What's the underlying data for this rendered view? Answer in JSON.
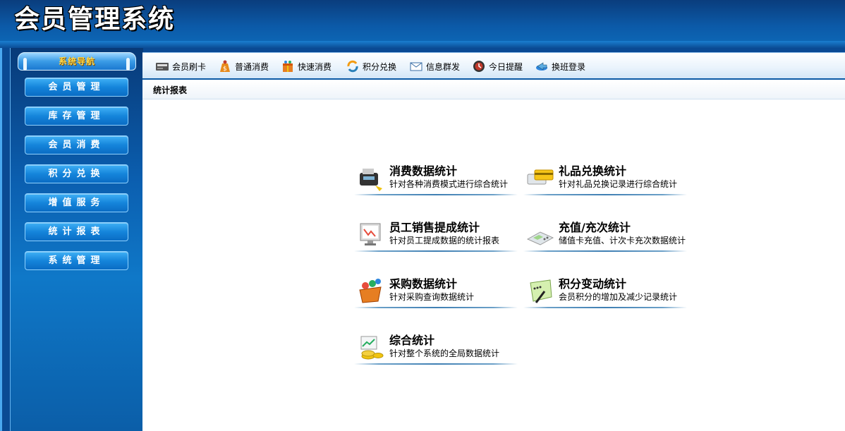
{
  "header": {
    "title": "会员管理系统"
  },
  "sidebar": {
    "heading": "系统导航",
    "items": [
      {
        "label": "会员管理"
      },
      {
        "label": "库存管理"
      },
      {
        "label": "会员消费"
      },
      {
        "label": "积分兑换"
      },
      {
        "label": "增值服务"
      },
      {
        "label": "统计报表"
      },
      {
        "label": "系统管理"
      }
    ]
  },
  "toolbar": {
    "items": [
      {
        "label": "会员刷卡",
        "icon": "card-reader-icon"
      },
      {
        "label": "普通消费",
        "icon": "money-bag-icon"
      },
      {
        "label": "快速消费",
        "icon": "gift-box-icon"
      },
      {
        "label": "积分兑换",
        "icon": "exchange-arrows-icon"
      },
      {
        "label": "信息群发",
        "icon": "envelope-icon"
      },
      {
        "label": "今日提醒",
        "icon": "alarm-icon"
      },
      {
        "label": "换班登录",
        "icon": "shift-login-icon"
      }
    ]
  },
  "content": {
    "title": "统计报表",
    "stats": [
      {
        "name": "消费数据统计",
        "desc": "针对各种消费模式进行综合统计",
        "icon": "pos-machine-icon"
      },
      {
        "name": "礼品兑换统计",
        "desc": "针对礼品兑换记录进行综合统计",
        "icon": "gift-cards-icon"
      },
      {
        "name": "员工销售提成统计",
        "desc": "针对员工提成数据的统计报表",
        "icon": "monitor-chart-icon"
      },
      {
        "name": "充值/充次统计",
        "desc": "储值卡充值、计次卡充次数据统计",
        "icon": "calculator-icon"
      },
      {
        "name": "采购数据统计",
        "desc": "针对采购查询数据统计",
        "icon": "shopping-basket-icon"
      },
      {
        "name": "积分变动统计",
        "desc": "会员积分的增加及减少记录统计",
        "icon": "notebook-pen-icon"
      },
      {
        "name": "综合统计",
        "desc": "针对整个系统的全局数据统计",
        "icon": "coins-chart-icon"
      }
    ]
  }
}
